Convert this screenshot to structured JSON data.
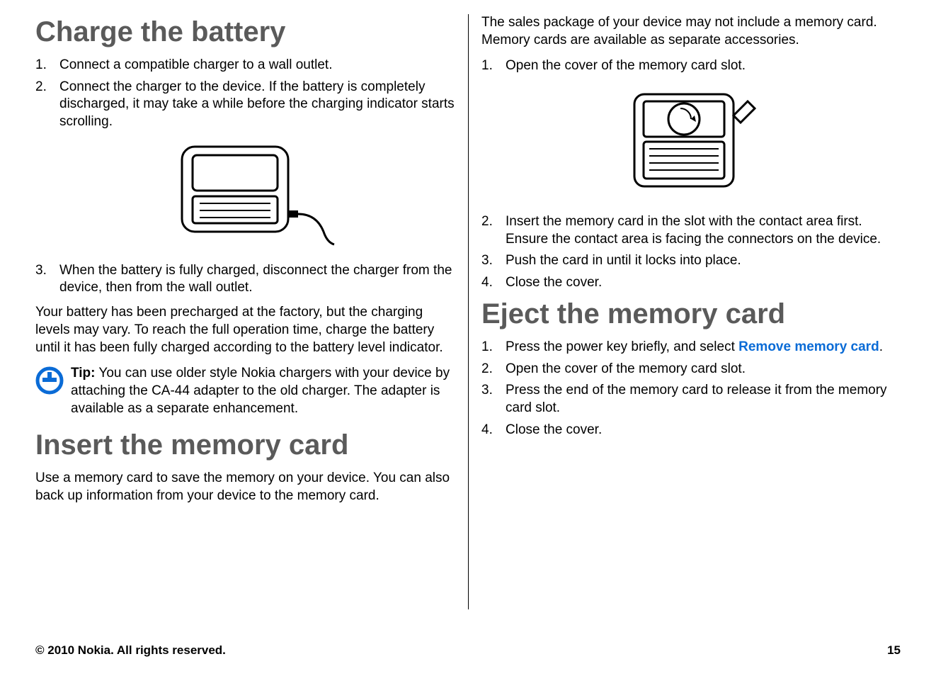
{
  "charge": {
    "heading": "Charge the battery",
    "steps": [
      "Connect a compatible charger to a wall outlet.",
      "Connect the charger to the device. If the battery is completely discharged, it may take a while before the charging indicator starts scrolling.",
      "When the battery is fully charged, disconnect the charger from the device, then from the wall outlet."
    ],
    "paragraph": "Your battery has been precharged at the factory, but the charging levels may vary. To reach the full operation time, charge the battery until it has been fully charged according to the battery level indicator.",
    "tip_label": "Tip:",
    "tip_text": " You can use older style Nokia chargers with your device by attaching the CA-44 adapter to the old charger. The adapter is available as a separate enhancement."
  },
  "insert": {
    "heading": "Insert the memory card",
    "paragraph": "Use a memory card to save the memory on your device. You can also back up information from your device to the memory card.",
    "paragraph2": "The sales package of your device may not include a memory card. Memory cards are available as separate accessories.",
    "steps": [
      "Open the cover of the memory card slot.",
      "Insert the memory card in the slot with the contact area first. Ensure the contact area is facing the connectors on the device.",
      "Push the card in until it locks into place.",
      "Close the cover."
    ]
  },
  "eject": {
    "heading": "Eject the memory card",
    "step1_prefix": "Press the power key briefly, and select ",
    "step1_link": "Remove memory card",
    "step1_suffix": ".",
    "steps_rest": [
      "Open the cover of the memory card slot.",
      "Press the end of the memory card to release it from the memory card slot.",
      "Close the cover."
    ]
  },
  "footer": {
    "copyright": "© 2010 Nokia. All rights reserved.",
    "page_number": "15"
  },
  "numbers": {
    "n1": "1.",
    "n2": "2.",
    "n3": "3.",
    "n4": "4."
  }
}
